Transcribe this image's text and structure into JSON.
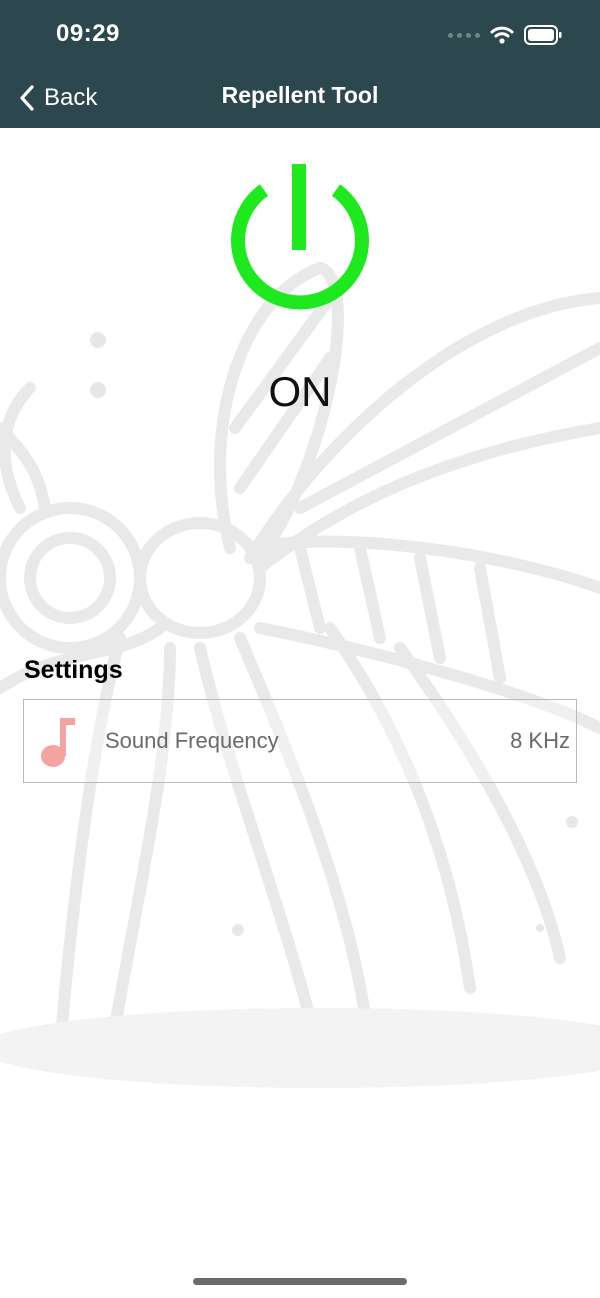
{
  "status_bar": {
    "time": "09:29"
  },
  "nav": {
    "back_label": "Back",
    "title": "Repellent Tool"
  },
  "power": {
    "state_label": "ON",
    "color": "#1ee81e"
  },
  "settings": {
    "title": "Settings",
    "items": [
      {
        "icon": "music-note-icon",
        "label": "Sound Frequency",
        "value": "8 KHz",
        "icon_color": "#f4a3a0"
      }
    ]
  },
  "colors": {
    "header": "#2c474d",
    "background_art": "#eeeeee"
  }
}
